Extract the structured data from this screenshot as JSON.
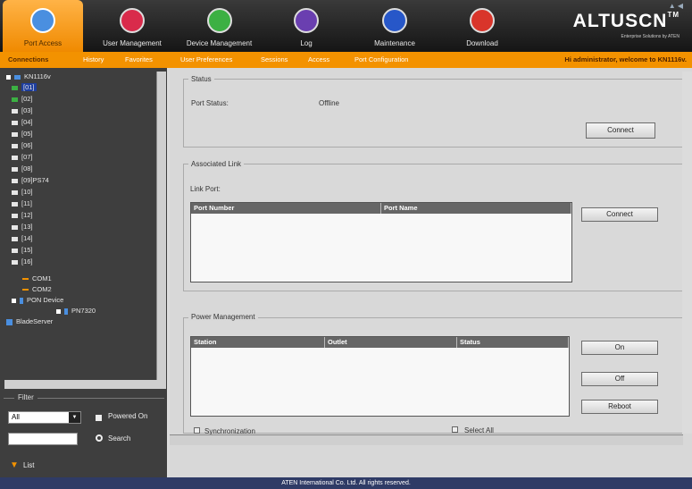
{
  "nav": {
    "items": [
      {
        "label": "Port Access",
        "icon": "port-access-icon",
        "color": "#f5f5f5"
      },
      {
        "label": "User Management",
        "icon": "user-management-icon",
        "color": "#d92b4b"
      },
      {
        "label": "Device Management",
        "icon": "device-management-icon",
        "color": "#3cb043"
      },
      {
        "label": "Log",
        "icon": "log-icon",
        "color": "#6a3fb0"
      },
      {
        "label": "Maintenance",
        "icon": "maintenance-icon",
        "color": "#2757c8"
      },
      {
        "label": "Download",
        "icon": "download-icon",
        "color": "#d9352b"
      }
    ],
    "logo": "ALTUSCN",
    "logo_tm": "TM",
    "logo_sub": "Enterprise Solutions by ATEN"
  },
  "subnav": {
    "items": [
      "Connections",
      "History",
      "Favorites",
      "User Preferences",
      "Sessions",
      "Access",
      "Port Configuration"
    ],
    "welcome": "Hi administrator, welcome to KN1116v."
  },
  "tree": {
    "root": "KN1116v",
    "ports": [
      "[01]",
      "[02]",
      "[03]",
      "[04]",
      "[05]",
      "[06]",
      "[07]",
      "[08]",
      "[09]PS74",
      "[10]",
      "[11]",
      "[12]",
      "[13]",
      "[14]",
      "[15]",
      "[16]"
    ],
    "com": [
      "COM1",
      "COM2"
    ],
    "pon": "PON Device",
    "pn": "PN7320",
    "blade": "BladeServer"
  },
  "filter": {
    "title": "Filter",
    "select_value": "All",
    "powered_on": "Powered On",
    "search": "Search",
    "list": "List"
  },
  "status": {
    "legend": "Status",
    "port_status_label": "Port Status:",
    "port_status_value": "Offline",
    "connect": "Connect"
  },
  "assoc": {
    "legend": "Associated Link",
    "link_port_label": "Link Port:",
    "columns": [
      "Port Number",
      "Port Name"
    ],
    "connect": "Connect"
  },
  "power": {
    "legend": "Power Management",
    "columns": [
      "Station",
      "Outlet",
      "Status"
    ],
    "on": "On",
    "off": "Off",
    "reboot": "Reboot",
    "sync": "Synchronization",
    "select_all": "Select All"
  },
  "footer": "ATEN International Co. Ltd. All rights reserved."
}
